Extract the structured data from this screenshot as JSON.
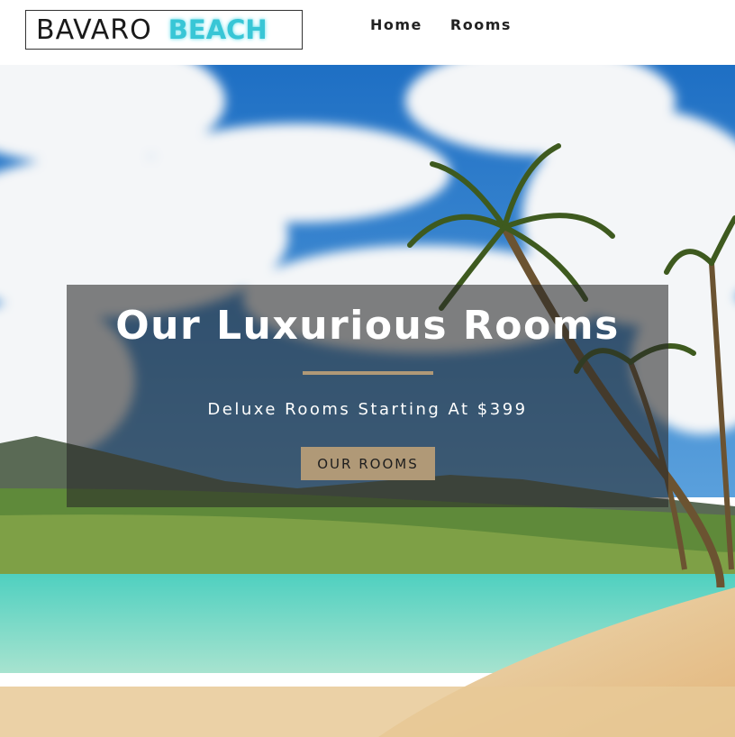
{
  "header": {
    "logo": {
      "word1": "BAVARO",
      "word2": "BEACH"
    },
    "nav": [
      {
        "label": "Home"
      },
      {
        "label": "Rooms"
      }
    ]
  },
  "hero": {
    "title": "Our Luxurious Rooms",
    "subtitle": "Deluxe Rooms Starting At $399",
    "button_label": "OUR ROOMS",
    "background": "tropical-beach-palm-trees-image"
  },
  "colors": {
    "accent": "#b09977",
    "logo_highlight": "#38c6d6",
    "overlay": "rgba(40,40,40,0.58)"
  }
}
